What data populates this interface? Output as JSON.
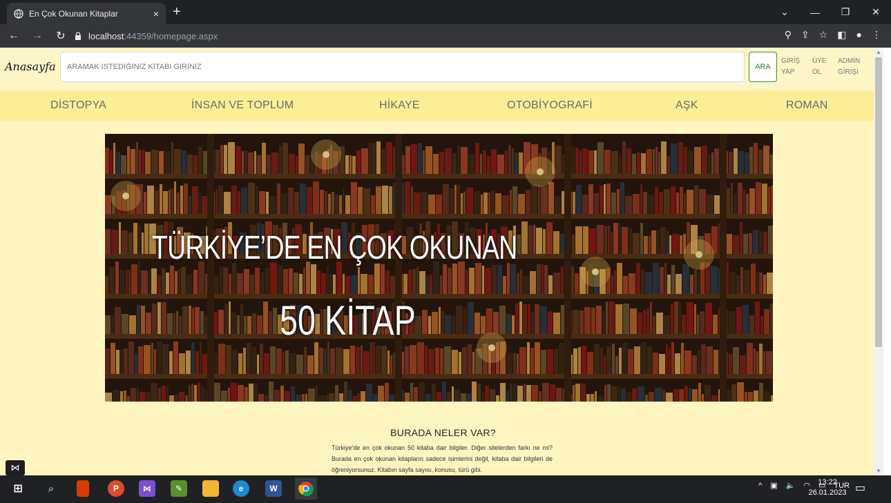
{
  "browser": {
    "tab_title": "En Çok Okunan Kitaplar",
    "tab_close": "×",
    "new_tab": "+",
    "url_host": "localhost",
    "url_path": ":44359/homepage.aspx",
    "window_controls": [
      "⌄",
      "—",
      "❐",
      "✕"
    ]
  },
  "header": {
    "brand": "Anasayfa",
    "search_placeholder": "ARAMAK İSTEDİĞİNİZ KİTABI GİRİNİZ",
    "search_button": "ARA",
    "login": "GİRİŞ YAP",
    "signup": "ÜYE OL",
    "admin": "ADMİN GİRİŞİ"
  },
  "categories": [
    "DİSTOPYA",
    "İNSAN VE TOPLUM",
    "HİKAYE",
    "OTOBİYOGRAFİ",
    "AŞK",
    "ROMAN"
  ],
  "hero": {
    "title": "TÜRKİYE’DE EN ÇOK OKUNAN",
    "subtitle": "50 KİTAP"
  },
  "section": {
    "title": "BURADA NELER VAR?",
    "body": "Türkiye'de en çok okunan 50 kitaba dair bilgiler. Diğer sitelerden farkı ne mi? Burada en çok okunan kitapların sadece isimlerini değil, kitaba dair bilgileri de öğreniyorsunuz. Kitabın sayfa sayısı, konusu, türü gibi."
  },
  "taskbar": {
    "language": "TUR",
    "time": "13:22",
    "date": "26.01.2023"
  }
}
